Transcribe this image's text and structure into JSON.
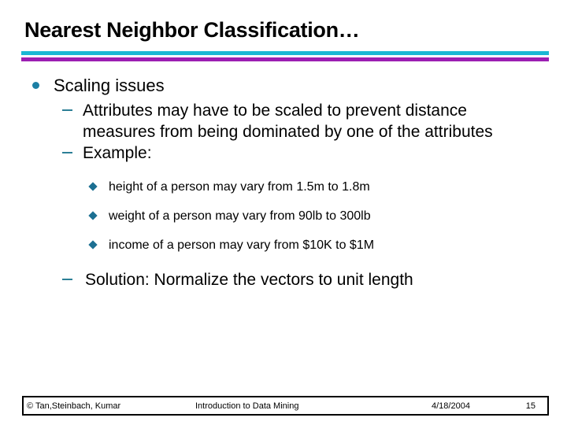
{
  "slide": {
    "title": "Nearest Neighbor Classification…",
    "accent_cyan": "#1ab8d4",
    "accent_purple": "#9c1fb2",
    "bullet_color": "#1c7fa4"
  },
  "content": {
    "level1": {
      "text": "Scaling issues",
      "bullet_icon": "filled-circle-bullet"
    },
    "level2": [
      {
        "text": "Attributes may have to be scaled to prevent distance measures from being dominated by one of the attributes",
        "bullet_icon": "en-dash-bullet"
      },
      {
        "text": "Example:",
        "bullet_icon": "en-dash-bullet"
      }
    ],
    "level3": [
      {
        "text": "height of a person may vary from 1.5m to 1.8m",
        "bullet_icon": "diamond-bullet"
      },
      {
        "text": "weight of a person may vary from 90lb to 300lb",
        "bullet_icon": "diamond-bullet"
      },
      {
        "text": "income of a person may vary from $10K to $1M",
        "bullet_icon": "diamond-bullet"
      }
    ],
    "solution": {
      "text": "Solution: Normalize the vectors to unit length",
      "bullet_icon": "en-dash-bullet"
    }
  },
  "footer": {
    "copyright": "© Tan,Steinbach, Kumar",
    "center": "Introduction to Data Mining",
    "date": "4/18/2004",
    "page": "15"
  }
}
